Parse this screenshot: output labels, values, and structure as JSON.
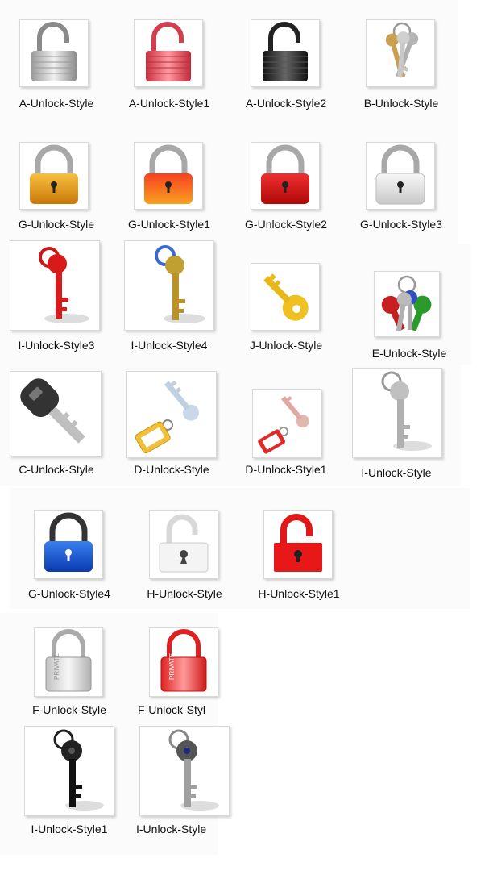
{
  "icons": [
    {
      "label": "A-Unlock-Style",
      "icon": "silver-unlocked-padlock-icon"
    },
    {
      "label": "A-Unlock-Style1",
      "icon": "pink-unlocked-padlock-icon"
    },
    {
      "label": "A-Unlock-Style2",
      "icon": "black-unlocked-padlock-icon"
    },
    {
      "label": "B-Unlock-Style",
      "icon": "key-bunch-icon"
    },
    {
      "label": "G-Unlock-Style",
      "icon": "orange-padlock-icon"
    },
    {
      "label": "G-Unlock-Style1",
      "icon": "red-orange-padlock-icon"
    },
    {
      "label": "G-Unlock-Style2",
      "icon": "red-padlock-icon"
    },
    {
      "label": "G-Unlock-Style3",
      "icon": "white-padlock-icon"
    },
    {
      "label": "I-Unlock-Style3",
      "icon": "red-key-icon"
    },
    {
      "label": "I-Unlock-Style4",
      "icon": "gold-key-icon"
    },
    {
      "label": "J-Unlock-Style",
      "icon": "yellow-key-icon"
    },
    {
      "label": "E-Unlock-Style",
      "icon": "colored-keys-icon"
    },
    {
      "label": "C-Unlock-Style",
      "icon": "car-key-icon"
    },
    {
      "label": "D-Unlock-Style",
      "icon": "key-with-tag-icon"
    },
    {
      "label": "D-Unlock-Style1",
      "icon": "key-with-red-tag-icon"
    },
    {
      "label": "I-Unlock-Style",
      "icon": "silver-key-icon"
    },
    {
      "label": "G-Unlock-Style4",
      "icon": "blue-padlock-icon"
    },
    {
      "label": "H-Unlock-Style",
      "icon": "white-open-padlock-icon"
    },
    {
      "label": "H-Unlock-Style1",
      "icon": "red-open-padlock-icon"
    },
    {
      "label": "F-Unlock-Style",
      "icon": "silver-private-padlock-icon"
    },
    {
      "label": "F-Unlock-Styl",
      "icon": "red-private-padlock-icon"
    },
    {
      "label": "I-Unlock-Style1",
      "icon": "black-key-icon"
    },
    {
      "label": "I-Unlock-Style",
      "icon": "dark-silver-key-icon"
    }
  ],
  "private_stamp": "PRIVATE",
  "colors": {
    "silver": "#b8b8b8",
    "pink": "#e85c68",
    "black": "#333333",
    "orange": "#e8a018",
    "red_orange": "#e84a16",
    "red": "#d81a1a",
    "white": "#e8e8e8",
    "blue": "#1a5ad8",
    "gold": "#c0a030",
    "yellow": "#f0c020"
  }
}
